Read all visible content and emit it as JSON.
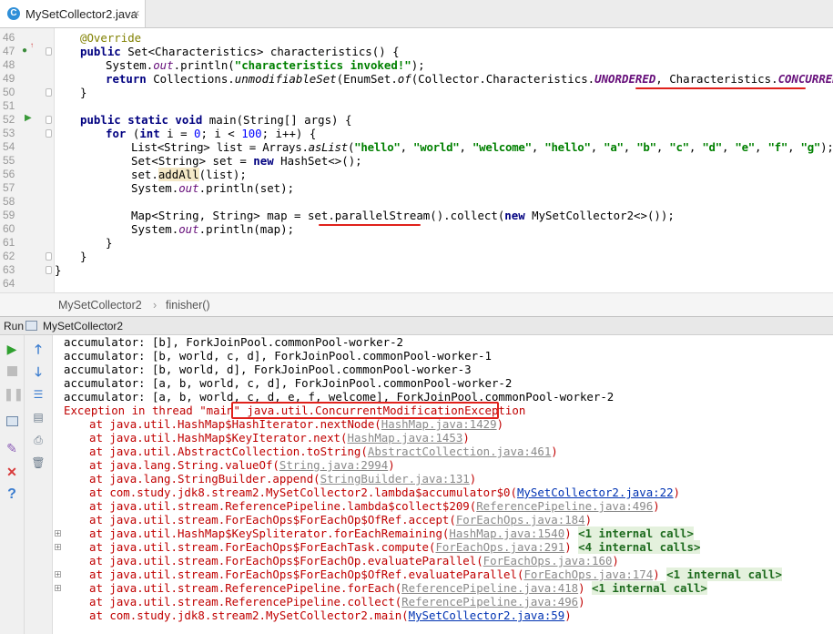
{
  "tab": {
    "icon": "C",
    "filename": "MySetCollector2.java",
    "close": "×"
  },
  "gutter": {
    "line_numbers": [
      "46",
      "47",
      "48",
      "49",
      "50",
      "51",
      "52",
      "53",
      "54",
      "55",
      "56",
      "57",
      "58",
      "59",
      "60",
      "61",
      "62",
      "63",
      "64"
    ]
  },
  "code": {
    "l46": "@Override",
    "l47a": "public ",
    "l47b": "Set<Characteristics> characteristics() {",
    "l48a": "System.",
    "l48b": "out",
    "l48c": ".println(",
    "l48d": "\"characteristics invoked!\"",
    "l48e": ");",
    "l49a": "return ",
    "l49b": "Collections.",
    "l49c": "unmodifiableSet",
    "l49d": "(EnumSet.",
    "l49e": "of",
    "l49f": "(Collector.Characteristics.",
    "l49g": "UNORDERED",
    "l49h": ", Characteristics.",
    "l49i": "CONCURRENT",
    "l49j": "));",
    "l50": "}",
    "l52a": "public static void ",
    "l52b": "main(String[] args) {",
    "l53a": "for ",
    "l53b": "(",
    "l53c": "int ",
    "l53d": "i = ",
    "l53e": "0",
    "l53f": "; i < ",
    "l53g": "100",
    "l53h": "; i++) {",
    "l54a": "List<String> list = Arrays.",
    "l54b": "asList",
    "l54c": "(",
    "l54s": [
      "\"hello\"",
      "\"world\"",
      "\"welcome\"",
      "\"hello\"",
      "\"a\"",
      "\"b\"",
      "\"c\"",
      "\"d\"",
      "\"e\"",
      "\"f\"",
      "\"g\""
    ],
    "l54sep": ", ",
    "l54end": ");",
    "l55a": "Set<String> set = ",
    "l55b": "new ",
    "l55c": "HashSet",
    "l55d": "<>();",
    "l56a": "set.",
    "l56b": "addAll",
    "l56c": "(list);",
    "l57a": "System.",
    "l57b": "out",
    "l57c": ".println(set);",
    "l59a": "Map<String, String> map = set.",
    "l59b": "parallelStream",
    "l59c": "().collect(",
    "l59d": "new ",
    "l59e": "MySetCollector2<>());",
    "l60a": "System.",
    "l60b": "out",
    "l60c": ".println(map);",
    "l61": "}",
    "l62": "}",
    "l63": "}"
  },
  "breadcrumb": {
    "class_name": "MySetCollector2",
    "separator": "›",
    "method": "finisher()"
  },
  "run": {
    "label": "Run",
    "config": "MySetCollector2"
  },
  "console": {
    "output": [
      "accumulator: [b], ForkJoinPool.commonPool-worker-2",
      "accumulator: [b, world, c, d], ForkJoinPool.commonPool-worker-1",
      "accumulator: [b, world, d], ForkJoinPool.commonPool-worker-3",
      "accumulator: [a, b, world, c, d], ForkJoinPool.commonPool-worker-2",
      "accumulator: [a, b, world, c, d, e, f, welcome], ForkJoinPool.commonPool-worker-2"
    ],
    "exception_prefix": "Exception in thread \"main\" ",
    "exception_class": "java.util.ConcurrentModificationException",
    "stack": [
      {
        "pre": "at java.util.HashMap$HashIterator.nextNode(",
        "link": "HashMap.java:1429",
        "post": ")",
        "note": "",
        "exp": false,
        "ours": false
      },
      {
        "pre": "at java.util.HashMap$KeyIterator.next(",
        "link": "HashMap.java:1453",
        "post": ")",
        "note": "",
        "exp": false,
        "ours": false
      },
      {
        "pre": "at java.util.AbstractCollection.toString(",
        "link": "AbstractCollection.java:461",
        "post": ")",
        "note": "",
        "exp": false,
        "ours": false
      },
      {
        "pre": "at java.lang.String.valueOf(",
        "link": "String.java:2994",
        "post": ")",
        "note": "",
        "exp": false,
        "ours": false
      },
      {
        "pre": "at java.lang.StringBuilder.append(",
        "link": "StringBuilder.java:131",
        "post": ")",
        "note": "",
        "exp": false,
        "ours": false
      },
      {
        "pre": "at com.study.jdk8.stream2.MySetCollector2.lambda$accumulator$0(",
        "link": "MySetCollector2.java:22",
        "post": ")",
        "note": "",
        "exp": false,
        "ours": true
      },
      {
        "pre": "at java.util.stream.ReferencePipeline.lambda$collect$209(",
        "link": "ReferencePipeline.java:496",
        "post": ")",
        "note": "",
        "exp": false,
        "ours": false
      },
      {
        "pre": "at java.util.stream.ForEachOps$ForEachOp$OfRef.accept(",
        "link": "ForEachOps.java:184",
        "post": ")",
        "note": "",
        "exp": false,
        "ours": false
      },
      {
        "pre": "at java.util.HashMap$KeySpliterator.forEachRemaining(",
        "link": "HashMap.java:1540",
        "post": ") ",
        "note": "<1 internal call>",
        "exp": true,
        "ours": false
      },
      {
        "pre": "at java.util.stream.ForEachOps$ForEachTask.compute(",
        "link": "ForEachOps.java:291",
        "post": ") ",
        "note": "<4 internal calls>",
        "exp": true,
        "ours": false
      },
      {
        "pre": "at java.util.stream.ForEachOps$ForEachOp.evaluateParallel(",
        "link": "ForEachOps.java:160",
        "post": ")",
        "note": "",
        "exp": false,
        "ours": false
      },
      {
        "pre": "at java.util.stream.ForEachOps$ForEachOp$OfRef.evaluateParallel(",
        "link": "ForEachOps.java:174",
        "post": ") ",
        "note": "<1 internal call>",
        "exp": true,
        "ours": false
      },
      {
        "pre": "at java.util.stream.ReferencePipeline.forEach(",
        "link": "ReferencePipeline.java:418",
        "post": ") ",
        "note": "<1 internal call>",
        "exp": true,
        "ours": false
      },
      {
        "pre": "at java.util.stream.ReferencePipeline.collect(",
        "link": "ReferencePipeline.java:496",
        "post": ")",
        "note": "",
        "exp": false,
        "ours": false
      },
      {
        "pre": "at com.study.jdk8.stream2.MySetCollector2.main(",
        "link": "MySetCollector2.java:59",
        "post": ")",
        "note": "",
        "exp": false,
        "ours": true
      }
    ],
    "expander_glyph": "+"
  },
  "icons": {
    "rerun": "run-icon",
    "stop": "stop-icon",
    "pause": "pause-icon",
    "up": "up-arrow-icon",
    "down": "down-arrow-icon",
    "wrap": "soft-wrap-icon",
    "dump": "dump-threads-icon",
    "print": "print-icon",
    "trash": "clear-all-icon",
    "pin": "pin-icon",
    "close": "close-icon",
    "help": "help-icon"
  },
  "colors": {
    "keyword": "#000080",
    "string": "#008000",
    "constant": "#660e7a",
    "error": "#c00000",
    "link": "#0033b3",
    "highlight": "#e0211b"
  }
}
